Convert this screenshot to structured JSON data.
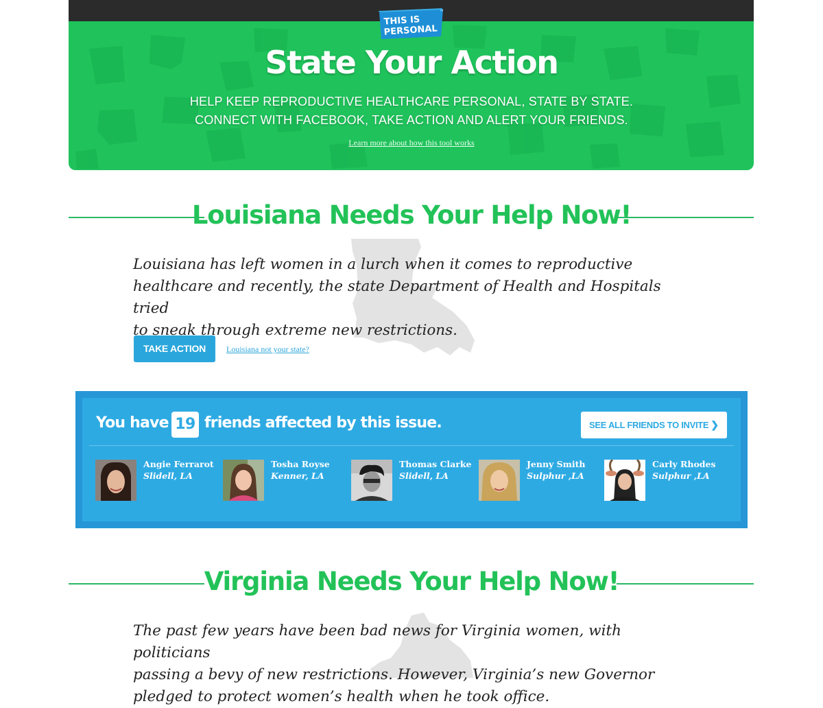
{
  "hero": {
    "logo_line1": "THIS IS",
    "logo_line2": "PERSONAL",
    "logo_tm": "™",
    "title": "State Your Action",
    "subtitle_line1": "HELP KEEP REPRODUCTIVE HEALTHCARE PERSONAL, STATE BY STATE.",
    "subtitle_line2": "CONNECT WITH FACEBOOK, TAKE ACTION AND ALERT YOUR FRIENDS.",
    "learn_more_link": "Learn more about how this tool works"
  },
  "louisiana": {
    "heading": "Louisiana Needs Your Help Now!",
    "body_line1": "Louisiana has left women in a lurch when it comes to reproductive",
    "body_line2": "healthcare and recently, the state Department of Health and Hospitals tried",
    "body_line3": "to sneak through extreme new restrictions.",
    "take_action_label": "TAKE ACTION",
    "not_your_state_link": "Louisiana not your state?"
  },
  "friends_panel": {
    "prefix": "You have",
    "count": "19",
    "suffix": "friends affected by this issue.",
    "see_all_label": "SEE ALL FRIENDS TO INVITE",
    "see_all_chevron": "❯",
    "friends": [
      {
        "name": "Angie Ferrarot",
        "location": "Slidell, LA"
      },
      {
        "name": "Tosha Royse",
        "location": "Kenner, LA"
      },
      {
        "name": "Thomas Clarke",
        "location": "Slidell, LA"
      },
      {
        "name": "Jenny Smith",
        "location": "Sulphur ,LA"
      },
      {
        "name": "Carly Rhodes",
        "location": "Sulphur ,LA"
      }
    ]
  },
  "virginia": {
    "heading": "Virginia Needs Your Help Now!",
    "body_line1": "The past few years have been bad news for Virginia women, with politicians",
    "body_line2": "passing a bevy of new restrictions. However, Virginia’s new Governor",
    "body_line3": "pledged to protect women’s health when he took office."
  },
  "colors": {
    "brand_green": "#1fc25b",
    "heading_green": "#22c258",
    "accent_blue": "#2eaae3",
    "panel_border_blue": "#2696d6",
    "top_bar": "#2b2b2b"
  }
}
